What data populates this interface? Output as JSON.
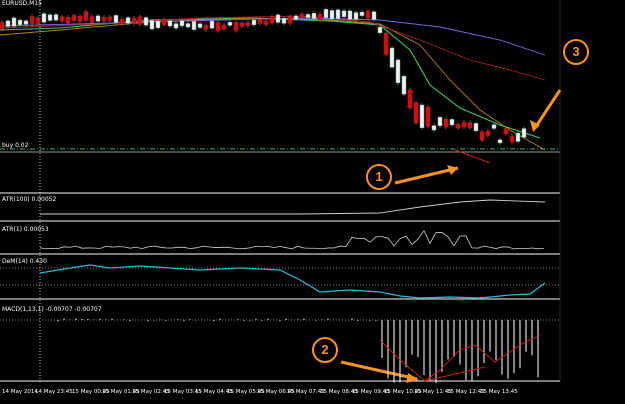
{
  "colors": {
    "background": "#000000",
    "separator": "#c8c8c8",
    "candle_up": "#ffffff",
    "candle_down": "#cc1111",
    "ma_fast": "#2ecc71",
    "ma_mid": "#b8860b",
    "ma_slow": "#b22222",
    "ma_long": "#7b68ee",
    "buy_line": "#3cb371",
    "rsi_line": "#2bbbd8",
    "indicator_line": "#d0d0d0",
    "macd_signal": "#cc2222",
    "annotation": "#f7941d"
  },
  "main_panel": {
    "symbol_label": "EURUSD,M15",
    "buy_label": "buy 0.02"
  },
  "indicators": {
    "atr100_label": "ATR(100) 0.00052",
    "atr1_label": "ATR(1) 0.00053",
    "rsi_label": "DeM(14) 0.430",
    "macd_label": "MACD(1,13,1) -0.00707 -0.00707"
  },
  "annotations": [
    {
      "number": "1"
    },
    {
      "number": "2"
    },
    {
      "number": "3"
    }
  ],
  "time_axis": [
    "14 May 2014",
    "14 May 23:45",
    "15 May 00:45",
    "15 May 01:45",
    "15 May 02:45",
    "15 May 03:45",
    "15 May 04:45",
    "15 May 05:45",
    "15 May 06:45",
    "15 May 07:45",
    "15 May 08:45",
    "15 May 09:45",
    "15 May 10:45",
    "15 May 11:45",
    "15 May 12:45",
    "15 May 13:45"
  ]
}
